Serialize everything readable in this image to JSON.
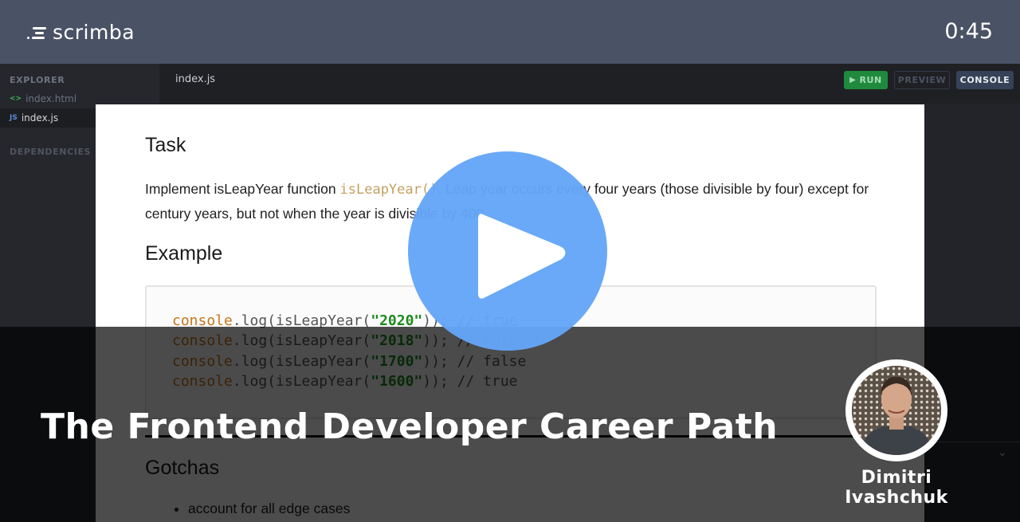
{
  "app": {
    "brand": "scrimba",
    "timer": "0:45"
  },
  "sidebar": {
    "explorer_label": "EXPLORER",
    "files": [
      {
        "icon": "html-icon",
        "icon_glyph": "<>",
        "name": "index.html",
        "active": false
      },
      {
        "icon": "js-icon",
        "icon_glyph": "JS",
        "name": "index.js",
        "active": true
      }
    ],
    "dependencies_label": "DEPENDENCIES"
  },
  "editor": {
    "active_tab": "index.js",
    "buttons": {
      "run": "RUN",
      "preview": "PREVIEW",
      "console": "CONSOLE"
    }
  },
  "document": {
    "task_heading": "Task",
    "task_text_before": "Implement isLeapYear function ",
    "task_code": "isLeapYear()",
    "task_text_after": ". Leap year occurs every four years (those divisible by four) except for century years, but not when the year is divisible by 400.",
    "example_heading": "Example",
    "code_lines": [
      {
        "obj": "console",
        "call": ".log(isLeapYear(",
        "arg": "\"2020\"",
        "rest": ")); // true"
      },
      {
        "obj": "console",
        "call": ".log(isLeapYear(",
        "arg": "\"2018\"",
        "rest": ")); // false"
      },
      {
        "obj": "console",
        "call": ".log(isLeapYear(",
        "arg": "\"1700\"",
        "rest": ")); // false"
      },
      {
        "obj": "console",
        "call": ".log(isLeapYear(",
        "arg": "\"1600\"",
        "rest": ")); // true"
      }
    ],
    "gotchas_heading": "Gotchas",
    "gotchas": [
      "account for all edge cases"
    ]
  },
  "overlay": {
    "course_title": "The Frontend Developer Career Path",
    "author_name": "Dimitri Ivashchuk",
    "play_color": "#64a6f8"
  }
}
